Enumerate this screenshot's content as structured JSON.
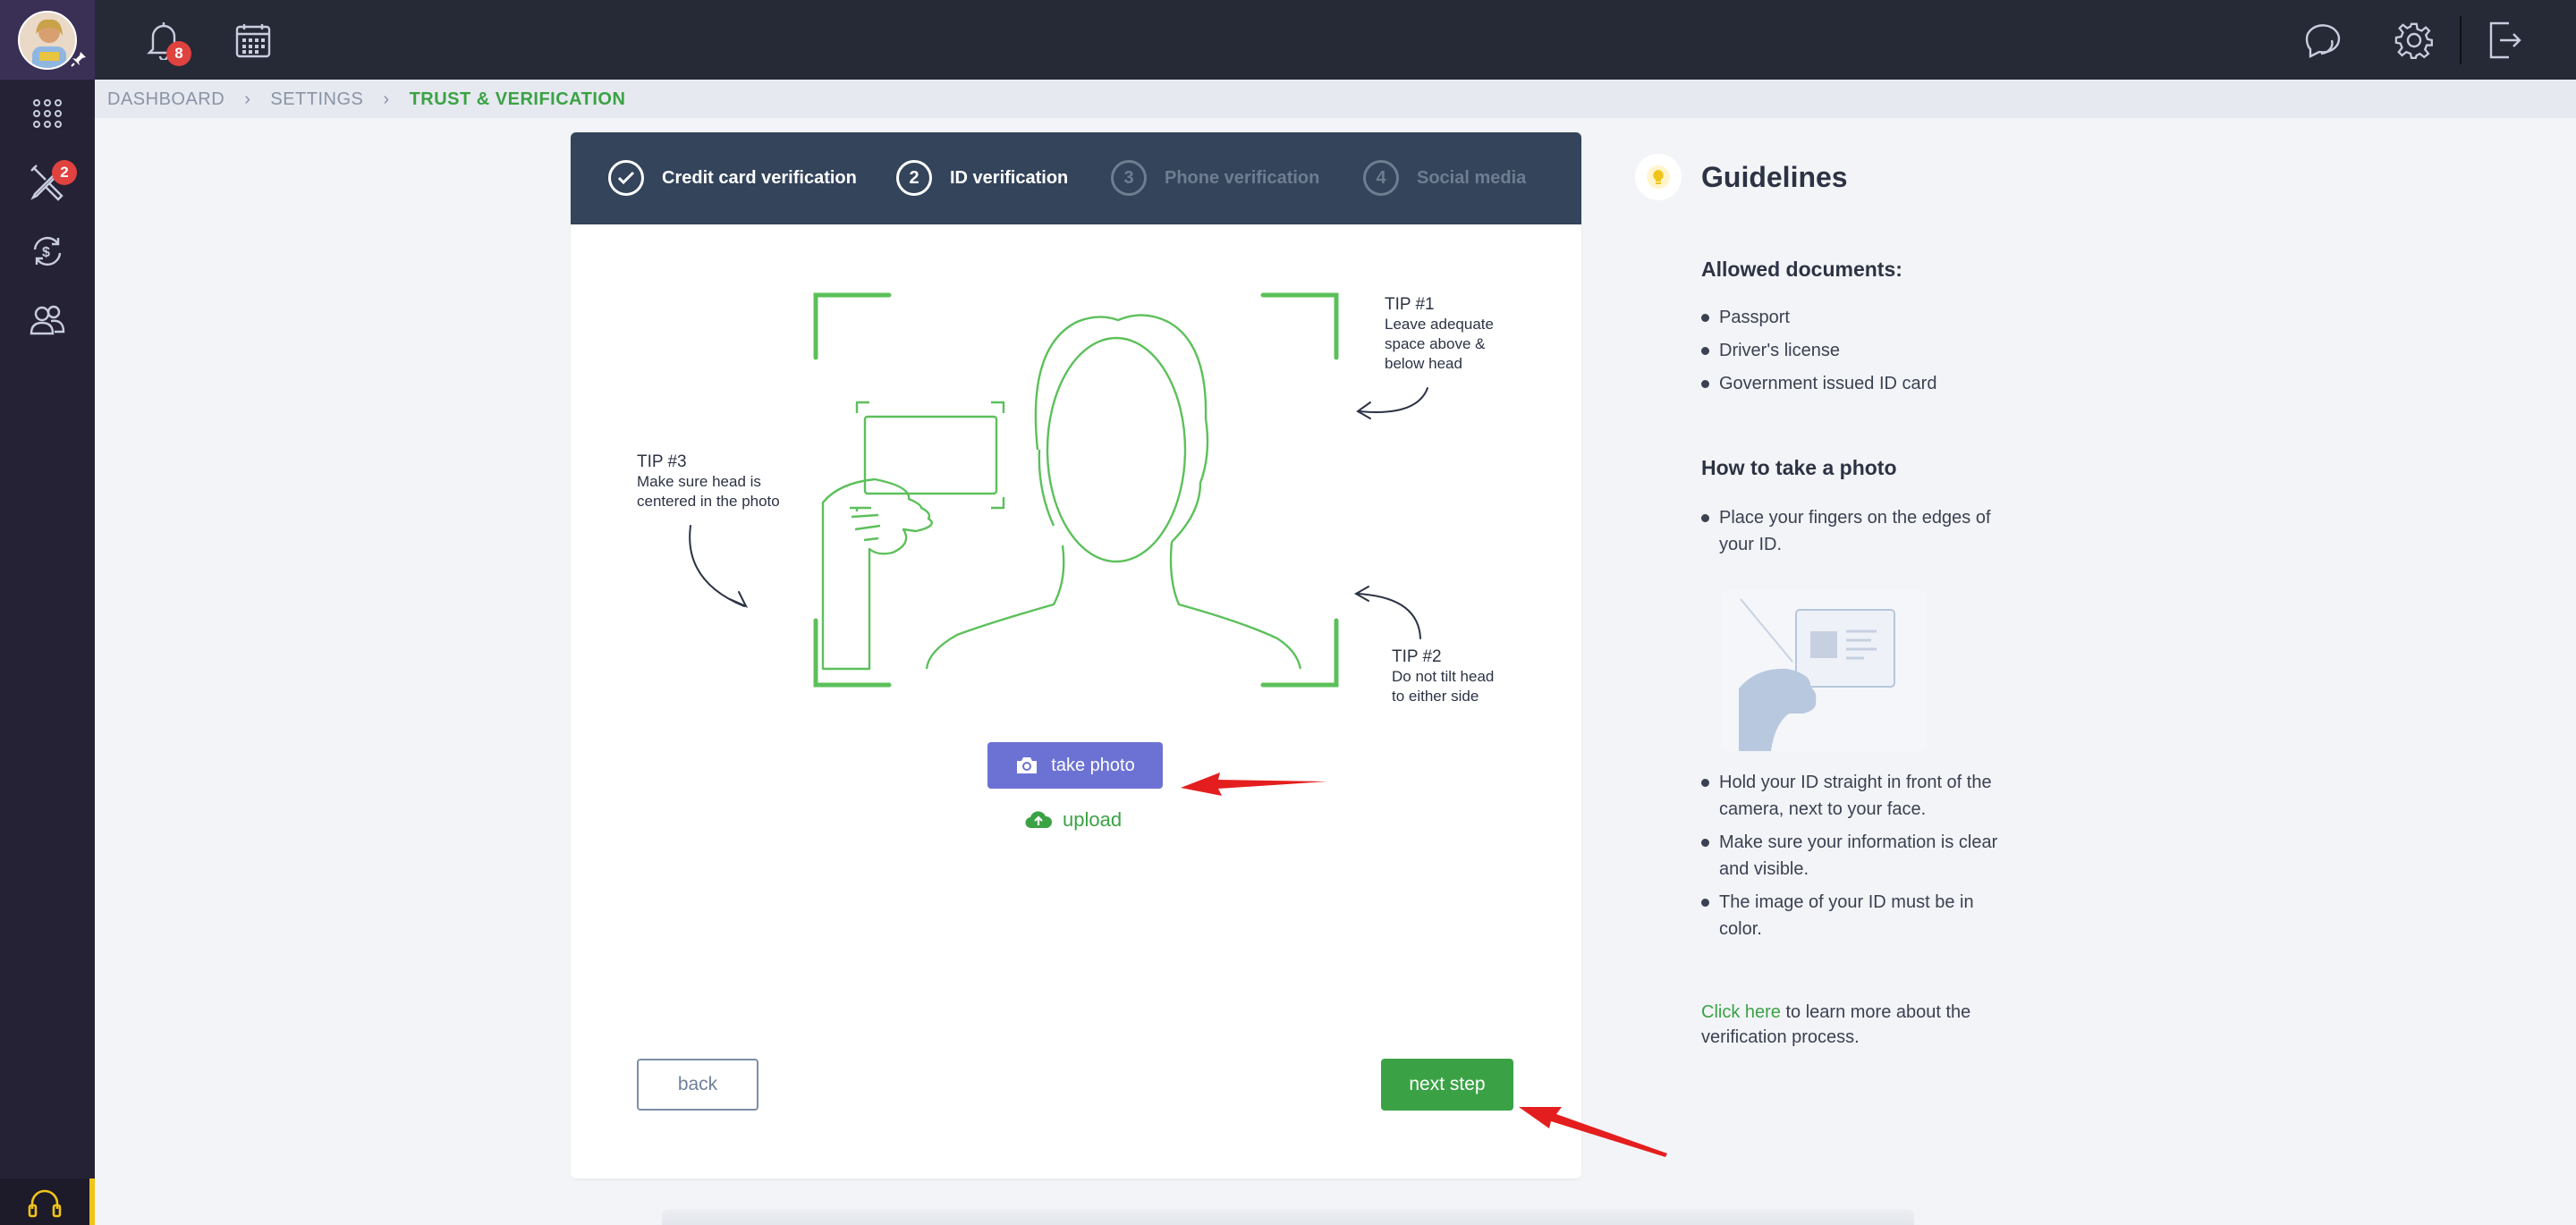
{
  "sidebar": {
    "badge_tools": "2",
    "items": [
      {
        "name": "apps-grid-icon"
      },
      {
        "name": "tools-icon"
      },
      {
        "name": "money-exchange-icon"
      },
      {
        "name": "users-icon"
      }
    ]
  },
  "topbar": {
    "notifications_badge": "8"
  },
  "breadcrumb": {
    "items": [
      "DASHBOARD",
      "SETTINGS",
      "TRUST & VERIFICATION"
    ]
  },
  "stepper": {
    "steps": [
      {
        "label": "Credit card verification",
        "state": "done",
        "number": "✓"
      },
      {
        "label": "ID verification",
        "state": "active",
        "number": "2"
      },
      {
        "label": "Phone verification",
        "state": "inactive",
        "number": "3"
      },
      {
        "label": "Social media",
        "state": "inactive",
        "number": "4"
      }
    ]
  },
  "tips": {
    "tip1": {
      "title": "TIP #1",
      "text1": "Leave adequate",
      "text2": "space above &",
      "text3": "below head"
    },
    "tip2": {
      "title": "TIP #2",
      "text1": "Do not tilt head",
      "text2": "to either side"
    },
    "tip3": {
      "title": "TIP #3",
      "text1": "Make sure head is",
      "text2": "centered in the photo"
    }
  },
  "actions": {
    "take_photo": "take photo",
    "upload": "upload",
    "back": "back",
    "next": "next step"
  },
  "guidelines": {
    "title": "Guidelines",
    "allowed_title": "Allowed documents:",
    "allowed": [
      "Passport",
      "Driver's license",
      "Government issued ID card"
    ],
    "howto_title": "How to take a photo",
    "howto_first": "Place your fingers on the edges of your ID.",
    "howto_rest": [
      "Hold your ID straight in front of the camera, next to your face.",
      "Make sure your information is clear and visible.",
      "The image of your ID must be in color."
    ],
    "link_text": "Click here",
    "link_rest": " to learn more about the verification process."
  },
  "colors": {
    "accent_green": "#3aa245",
    "button_purple": "#6c72d4",
    "stepper_bg": "#33445b",
    "badge_red": "#e0423f"
  }
}
